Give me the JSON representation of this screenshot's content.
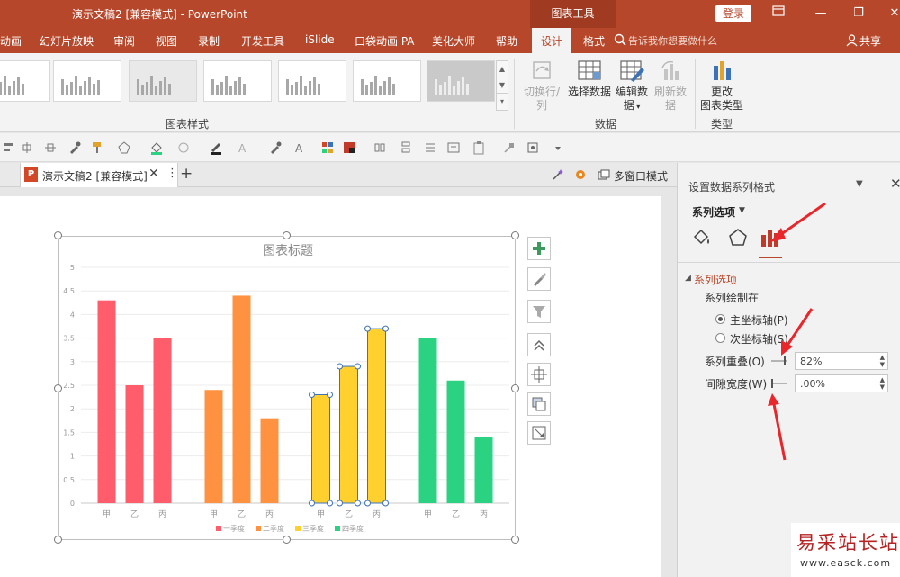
{
  "window": {
    "title": "演示文稿2 [兼容模式] - PowerPoint",
    "context_tab": "图表工具",
    "login_label": "登录",
    "minimize": "—",
    "restore": "❐",
    "close": "✕"
  },
  "tabs": [
    {
      "label": "动画"
    },
    {
      "label": "幻灯片放映"
    },
    {
      "label": "审阅"
    },
    {
      "label": "视图"
    },
    {
      "label": "录制"
    },
    {
      "label": "开发工具"
    },
    {
      "label": "iSlide"
    },
    {
      "label": "口袋动画 PA"
    },
    {
      "label": "美化大师"
    },
    {
      "label": "帮助"
    },
    {
      "label": "设计"
    },
    {
      "label": "格式"
    }
  ],
  "tell_me": "告诉我你想要做什么",
  "share_label": "共享",
  "ribbon": {
    "chart_styles_label": "图表样式",
    "data_group_label": "数据",
    "type_group_label": "类型",
    "switch_row_col": "切换行/列",
    "select_data": "选择数据",
    "edit_data_line1": "编辑数",
    "edit_data_line2": "据",
    "refresh_data": "刷新数据",
    "change_type_line1": "更改",
    "change_type_line2": "图表类型"
  },
  "document_tab": {
    "name": "演示文稿2 [兼容模式]",
    "close": "✕",
    "more": "⋮",
    "add": "+",
    "multi_window": "多窗口模式",
    "badge": "P"
  },
  "chart_data": {
    "type": "bar",
    "title": "图表标题",
    "categories": [
      "甲",
      "乙",
      "丙"
    ],
    "groups": [
      "一季度",
      "二季度",
      "三季度",
      "四季度"
    ],
    "series": [
      {
        "name": "一季度",
        "color": "#ff5d6c",
        "values": [
          4.3,
          2.5,
          3.5
        ]
      },
      {
        "name": "二季度",
        "color": "#ff9240",
        "values": [
          2.4,
          4.4,
          1.8
        ]
      },
      {
        "name": "三季度",
        "color": "#ffd02e",
        "values": [
          2.3,
          2.9,
          3.7
        ]
      },
      {
        "name": "四季度",
        "color": "#2bd282",
        "values": [
          3.5,
          2.6,
          1.4
        ]
      }
    ],
    "ylim": [
      0,
      5
    ],
    "yticks": [
      "0",
      "0.5",
      "1",
      "1.5",
      "2",
      "2.5",
      "3",
      "3.5",
      "4",
      "4.5",
      "5"
    ],
    "grid": true,
    "legend_position": "bottom",
    "selected_series": "三季度"
  },
  "pane": {
    "title": "设置数据系列格式",
    "series_options_dropdown": "系列选项",
    "section_title": "系列选项",
    "plot_series_on": "系列绘制在",
    "primary_axis": "主坐标轴(P)",
    "secondary_axis": "次坐标轴(S)",
    "overlap_label": "系列重叠(O)",
    "overlap_value": "82%",
    "gap_label": "间隙宽度(W)",
    "gap_value": ".00%"
  },
  "watermark": {
    "brand": "易采站长站",
    "url": "www.easck.com"
  }
}
